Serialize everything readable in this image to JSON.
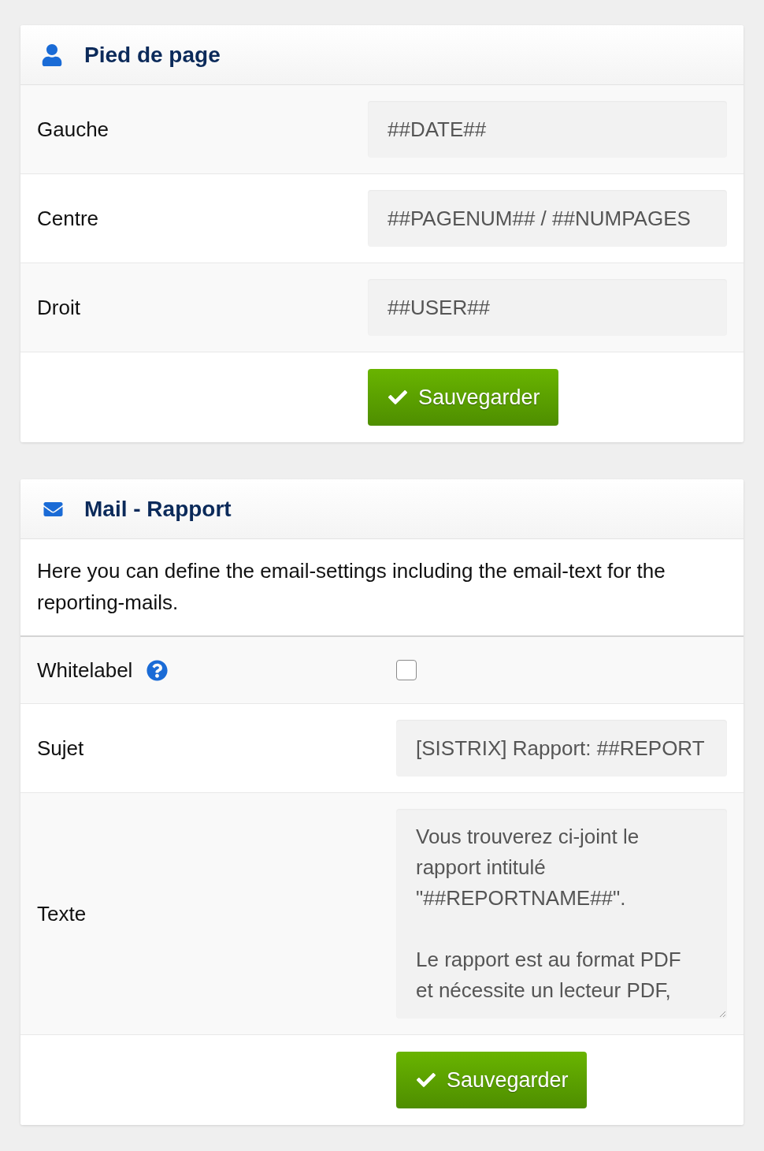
{
  "panels": [
    {
      "title": "Pied de page",
      "rows": [
        {
          "kind": "input",
          "label": "Gauche",
          "value": "##DATE##"
        },
        {
          "kind": "input",
          "label": "Centre",
          "value": "##PAGENUM## / ##NUMPAGES"
        },
        {
          "kind": "input",
          "label": "Droit",
          "value": "##USER##"
        }
      ],
      "save_button": "Sauvegarder"
    },
    {
      "title": "Mail - Rapport",
      "description": "Here you can define the email-settings including the email-text for the reporting-mails.",
      "rows": [
        {
          "kind": "checkbox",
          "label": "Whitelabel",
          "help": true,
          "checked": false
        },
        {
          "kind": "input",
          "label": "Sujet",
          "value": "[SISTRIX] Rapport: ##REPORT"
        },
        {
          "kind": "textarea",
          "label": "Texte",
          "value": "Vous trouverez ci-joint le rapport intitulé \"##REPORTNAME##\".\n\nLe rapport est au format PDF et nécessite un lecteur PDF,"
        }
      ],
      "save_button": "Sauvegarder"
    }
  ]
}
